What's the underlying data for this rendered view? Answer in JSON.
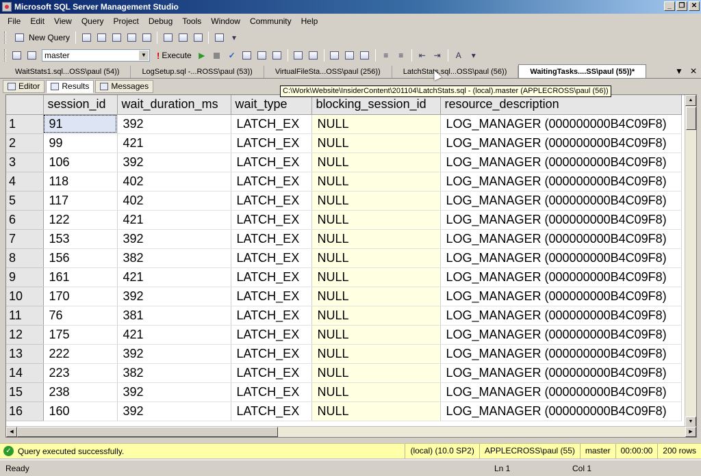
{
  "window": {
    "title": "Microsoft SQL Server Management Studio"
  },
  "menu": [
    "File",
    "Edit",
    "View",
    "Query",
    "Project",
    "Debug",
    "Tools",
    "Window",
    "Community",
    "Help"
  ],
  "toolbar": {
    "new_query_label": "New Query",
    "database": "master",
    "execute_label": "Execute"
  },
  "doc_tabs": [
    {
      "label": "WaitStats1.sql...OSS\\paul (54))"
    },
    {
      "label": "LogSetup.sql -...ROSS\\paul (53))"
    },
    {
      "label": "VirtualFileSta...OSS\\paul (256))"
    },
    {
      "label": "LatchStats.sql...OSS\\paul (56))"
    },
    {
      "label": "WaitingTasks....SS\\paul (55))*"
    }
  ],
  "tooltip": "C:\\Work\\Website\\InsiderContent\\201104\\LatchStats.sql - (local).master (APPLECROSS\\paul (56))",
  "result_tabs": {
    "editor": "Editor",
    "results": "Results",
    "messages": "Messages"
  },
  "grid": {
    "columns": [
      "session_id",
      "wait_duration_ms",
      "wait_type",
      "blocking_session_id",
      "resource_description"
    ],
    "rows": [
      [
        "1",
        "91",
        "392",
        "LATCH_EX",
        "NULL",
        "LOG_MANAGER (000000000B4C09F8)"
      ],
      [
        "2",
        "99",
        "421",
        "LATCH_EX",
        "NULL",
        "LOG_MANAGER (000000000B4C09F8)"
      ],
      [
        "3",
        "106",
        "392",
        "LATCH_EX",
        "NULL",
        "LOG_MANAGER (000000000B4C09F8)"
      ],
      [
        "4",
        "118",
        "402",
        "LATCH_EX",
        "NULL",
        "LOG_MANAGER (000000000B4C09F8)"
      ],
      [
        "5",
        "117",
        "402",
        "LATCH_EX",
        "NULL",
        "LOG_MANAGER (000000000B4C09F8)"
      ],
      [
        "6",
        "122",
        "421",
        "LATCH_EX",
        "NULL",
        "LOG_MANAGER (000000000B4C09F8)"
      ],
      [
        "7",
        "153",
        "392",
        "LATCH_EX",
        "NULL",
        "LOG_MANAGER (000000000B4C09F8)"
      ],
      [
        "8",
        "156",
        "382",
        "LATCH_EX",
        "NULL",
        "LOG_MANAGER (000000000B4C09F8)"
      ],
      [
        "9",
        "161",
        "421",
        "LATCH_EX",
        "NULL",
        "LOG_MANAGER (000000000B4C09F8)"
      ],
      [
        "10",
        "170",
        "392",
        "LATCH_EX",
        "NULL",
        "LOG_MANAGER (000000000B4C09F8)"
      ],
      [
        "11",
        "76",
        "381",
        "LATCH_EX",
        "NULL",
        "LOG_MANAGER (000000000B4C09F8)"
      ],
      [
        "12",
        "175",
        "421",
        "LATCH_EX",
        "NULL",
        "LOG_MANAGER (000000000B4C09F8)"
      ],
      [
        "13",
        "222",
        "392",
        "LATCH_EX",
        "NULL",
        "LOG_MANAGER (000000000B4C09F8)"
      ],
      [
        "14",
        "223",
        "382",
        "LATCH_EX",
        "NULL",
        "LOG_MANAGER (000000000B4C09F8)"
      ],
      [
        "15",
        "238",
        "392",
        "LATCH_EX",
        "NULL",
        "LOG_MANAGER (000000000B4C09F8)"
      ],
      [
        "16",
        "160",
        "392",
        "LATCH_EX",
        "NULL",
        "LOG_MANAGER (000000000B4C09F8)"
      ]
    ]
  },
  "query_status": {
    "message": "Query executed successfully.",
    "server": "(local) (10.0 SP2)",
    "user": "APPLECROSS\\paul (55)",
    "database": "master",
    "elapsed": "00:00:00",
    "rows": "200 rows"
  },
  "status_bar": {
    "state": "Ready",
    "line": "Ln 1",
    "col": "Col 1"
  }
}
